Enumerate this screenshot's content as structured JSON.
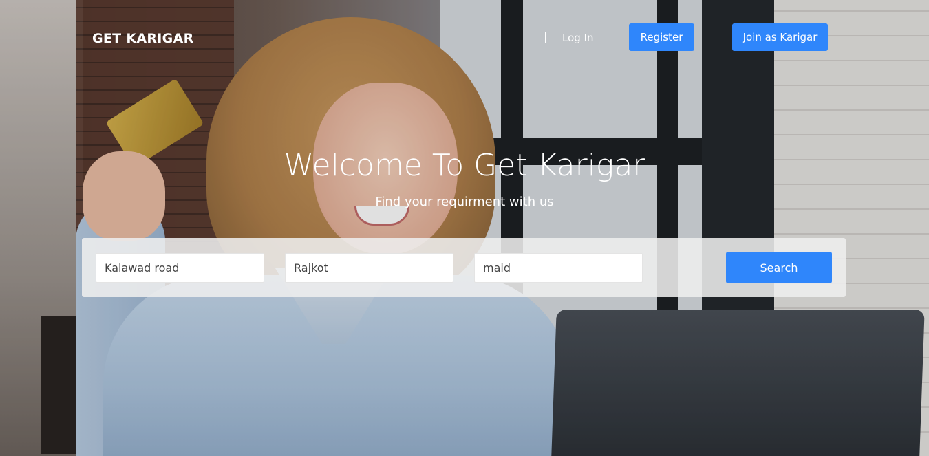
{
  "header": {
    "brand": "GET KARIGAR",
    "login_label": "Log In",
    "register_label": "Register",
    "join_label": "Join as Karigar"
  },
  "hero": {
    "title": "Welcome To Get Karigar",
    "subtitle": "Find your requirment with us"
  },
  "search": {
    "location_value": "Kalawad road",
    "city_value": "Rajkot",
    "service_value": "maid",
    "button_label": "Search"
  },
  "colors": {
    "accent": "#2f86fb",
    "text_on_hero": "#ffffff"
  }
}
